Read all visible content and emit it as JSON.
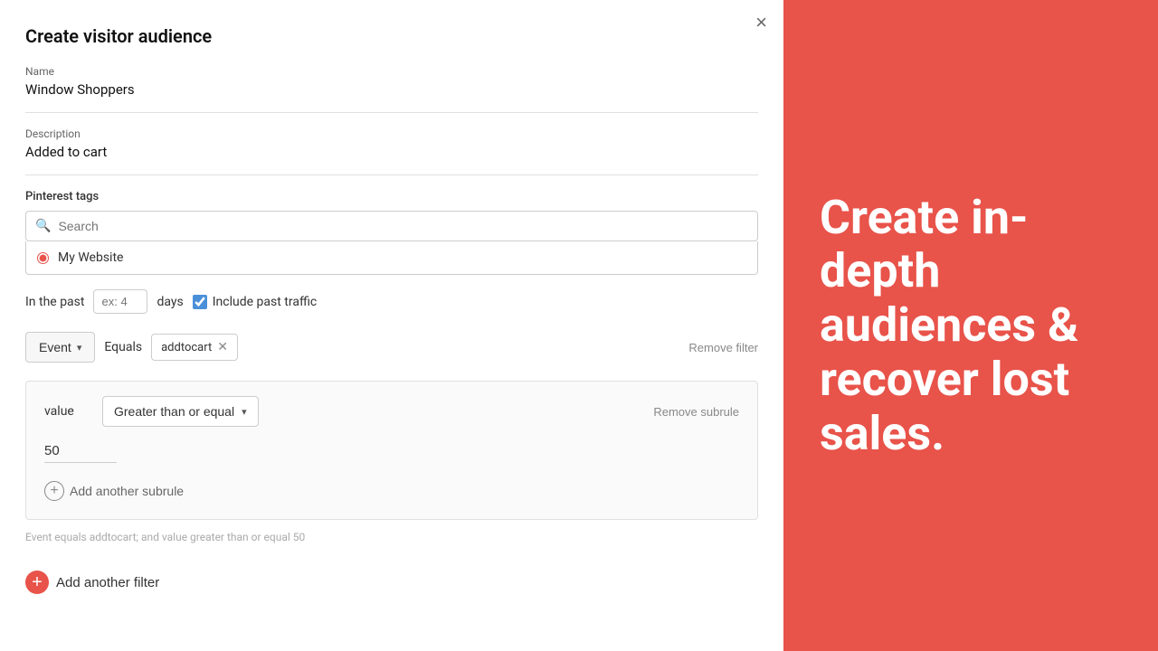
{
  "modal": {
    "title": "Create visitor audience",
    "close_label": "×"
  },
  "form": {
    "name_label": "Name",
    "name_value": "Window Shoppers",
    "description_label": "Description",
    "description_value": "Added to cart",
    "pinterest_tags_label": "Pinterest tags",
    "search_placeholder": "Search",
    "tag_option": "My Website",
    "past_label": "In the past",
    "days_placeholder": "ex: 4",
    "days_suffix": "days",
    "include_past_label": "Include past traffic",
    "filter": {
      "event_label": "Event",
      "equals_label": "Equals",
      "tag_chip": "addtocart",
      "remove_filter_label": "Remove filter"
    },
    "subrule": {
      "value_label": "value",
      "condition_label": "Greater than or equal",
      "remove_subrule_label": "Remove subrule",
      "value_input": "50",
      "add_subrule_label": "Add another subrule"
    },
    "summary_text": "Event equals addtocart; and value greater than or equal 50",
    "add_filter_label": "Add another filter"
  },
  "sidebar": {
    "text": "Create in-depth audiences & recover lost sales."
  },
  "colors": {
    "accent": "#e8534a"
  }
}
